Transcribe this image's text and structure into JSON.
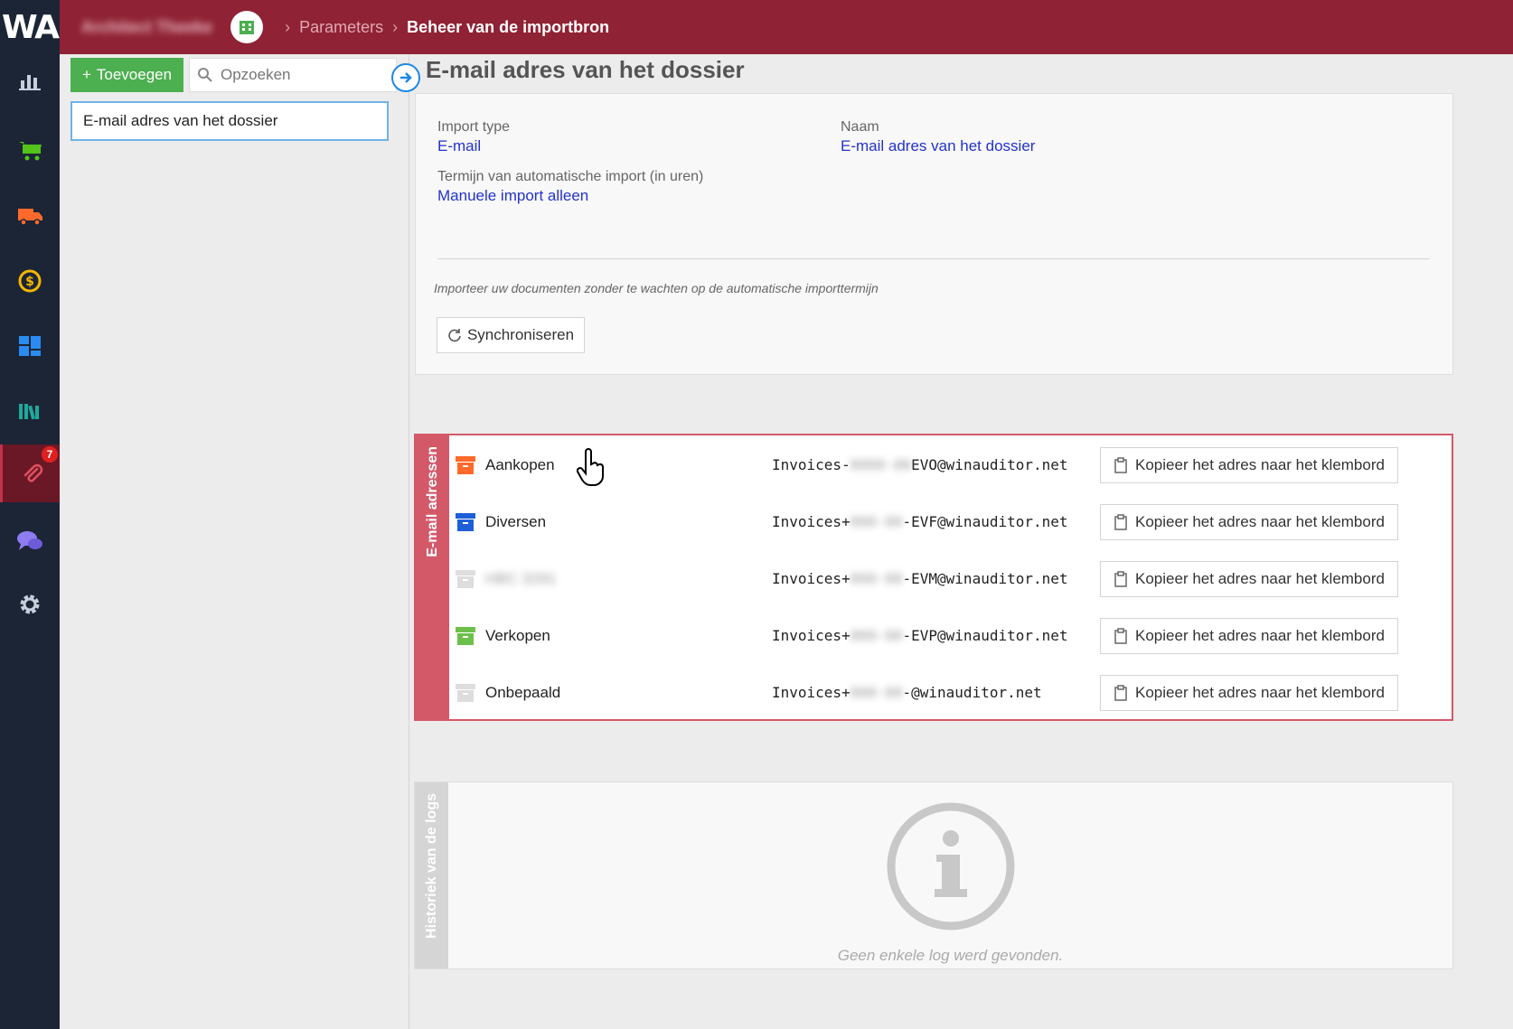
{
  "app": {
    "logo": "WA"
  },
  "rail": {
    "items": [
      {
        "icon": "chart-icon",
        "color": "#c7cfdd"
      },
      {
        "icon": "cart-icon",
        "color": "#52c41a"
      },
      {
        "icon": "truck-icon",
        "color": "#ff6a2b"
      },
      {
        "icon": "dollar-icon",
        "color": "#f5b700"
      },
      {
        "icon": "dashboard-icon",
        "color": "#2a8cf0"
      },
      {
        "icon": "books-icon",
        "color": "#1ea99a"
      },
      {
        "icon": "paperclip-icon",
        "color": "#e0505f",
        "badge": "7"
      },
      {
        "icon": "chat-icon",
        "color": "#8e7cf0"
      },
      {
        "icon": "gear-icon",
        "color": "#c7cfdd"
      }
    ]
  },
  "topbar": {
    "company": "Architect Theeke",
    "breadcrumb": [
      "Parameters",
      "Beheer van de importbron"
    ]
  },
  "listpanel": {
    "add_label": "Toevoegen",
    "search_placeholder": "Opzoeken",
    "items": [
      "E-mail adres van het dossier"
    ]
  },
  "main": {
    "title": "E-mail adres van het dossier",
    "import_type_label": "Import type",
    "import_type_value": "E-mail",
    "name_label": "Naam",
    "name_value": "E-mail adres van het dossier",
    "term_label": "Termijn van automatische import (in uren)",
    "term_value": "Manuele import alleen",
    "hint": "Importeer uw documenten zonder te wachten op de automatische importtermijn",
    "sync_label": "Synchroniseren"
  },
  "emails": {
    "tab_label": "E-mail adressen",
    "copy_label": "Kopieer het adres naar het klembord",
    "rows": [
      {
        "name": "Aankopen",
        "prefix": "Invoices-",
        "mask": "0000-00",
        "suffix": "EVO@winauditor.net",
        "color": "#ff6a2b"
      },
      {
        "name": "Diversen",
        "prefix": "Invoices+",
        "mask": "000-00",
        "suffix": "-EVF@winauditor.net",
        "color": "#1e5fd8"
      },
      {
        "name": "HBC 3291",
        "prefix": "Invoices+",
        "mask": "000-00",
        "suffix": "-EVM@winauditor.net",
        "color": "#dddddd",
        "blurred": true
      },
      {
        "name": "Verkopen",
        "prefix": "Invoices+",
        "mask": "000-00",
        "suffix": "-EVP@winauditor.net",
        "color": "#6cc04a"
      },
      {
        "name": "Onbepaald",
        "prefix": "Invoices+",
        "mask": "000-00",
        "suffix": "-@winauditor.net",
        "color": "#dddddd"
      }
    ]
  },
  "logs": {
    "tab_label": "Historiek van de logs",
    "empty_message": "Geen enkele log werd gevonden."
  }
}
